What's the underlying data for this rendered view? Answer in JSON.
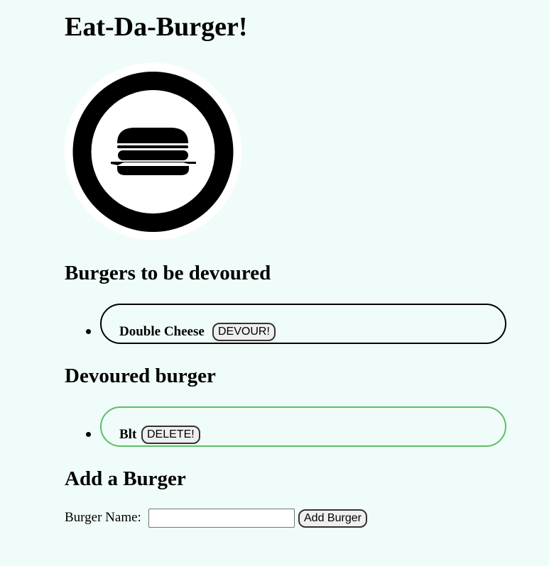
{
  "page": {
    "title": "Eat-Da-Burger!",
    "colors": {
      "background": "#f0fcf9",
      "devoured_border": "#5cbf64"
    }
  },
  "logo": {
    "icon": "burger-icon"
  },
  "to_devour": {
    "heading": "Burgers to be devoured",
    "items": [
      {
        "name": "Double Cheese",
        "button": "DEVOUR!"
      }
    ]
  },
  "devoured": {
    "heading": "Devoured burger",
    "items": [
      {
        "name": "Blt",
        "button": "DELETE!"
      }
    ]
  },
  "add_form": {
    "heading": "Add a Burger",
    "label": "Burger Name:",
    "input_value": "",
    "submit_label": "Add Burger"
  }
}
